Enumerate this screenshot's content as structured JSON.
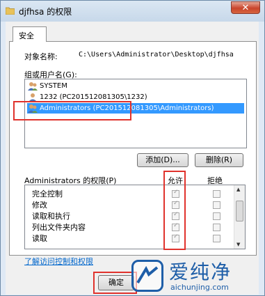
{
  "window": {
    "title": "djfhsa 的权限",
    "close_glyph": "✕"
  },
  "tab": {
    "label": "安全"
  },
  "object": {
    "label": "对象名称:",
    "value": "C:\\Users\\Administrator\\Desktop\\djfhsa"
  },
  "group": {
    "label": "组或用户名(G):",
    "items": [
      {
        "label": "SYSTEM"
      },
      {
        "label": "1232 (PC201512081305\\1232)"
      },
      {
        "label": "Administrators (PC201512081305\\Administrators)"
      }
    ]
  },
  "buttons": {
    "add": "添加(D)...",
    "remove": "删除(R)",
    "ok": "确定"
  },
  "permissions": {
    "label": "Administrators 的权限(P)",
    "allow_header": "允许",
    "deny_header": "拒绝",
    "rows": [
      {
        "name": "完全控制",
        "allow": true,
        "deny": false
      },
      {
        "name": "修改",
        "allow": true,
        "deny": false
      },
      {
        "name": "读取和执行",
        "allow": true,
        "deny": false
      },
      {
        "name": "列出文件夹内容",
        "allow": true,
        "deny": false
      },
      {
        "name": "读取",
        "allow": true,
        "deny": false
      }
    ]
  },
  "link": {
    "label": "了解访问控制和权限"
  },
  "watermark": {
    "cn": "爱纯净",
    "en": "aichunjing.com"
  },
  "colors": {
    "selection": "#3399ff",
    "highlight_box": "#e0322c",
    "link": "#0066cc",
    "watermark": "#1e5ea8"
  }
}
